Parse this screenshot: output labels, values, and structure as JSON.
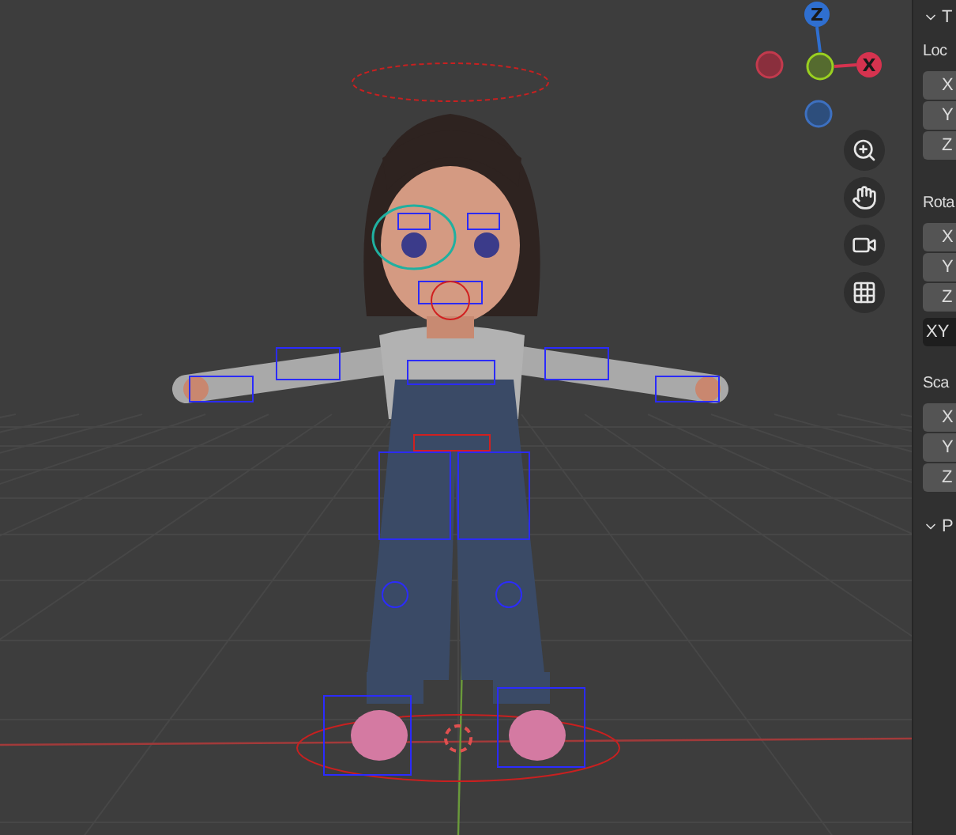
{
  "viewport": {
    "gizmo": {
      "axes": [
        {
          "kind": "z",
          "label": "Z"
        },
        {
          "kind": "x",
          "label": "X"
        }
      ]
    },
    "nav_buttons": [
      {
        "kind": "zoom"
      },
      {
        "kind": "pan"
      },
      {
        "kind": "camera"
      },
      {
        "kind": "perspective"
      }
    ]
  },
  "sidebar": {
    "panels": [
      {
        "header": "T",
        "expanded": true,
        "groups": [
          {
            "label": "Loc",
            "fields": [
              "X",
              "Y",
              "Z"
            ]
          },
          {
            "label": "Rota",
            "fields": [
              "X",
              "Y",
              "Z"
            ],
            "mode": "XY"
          },
          {
            "label": "Sca",
            "fields": [
              "X",
              "Y",
              "Z"
            ]
          }
        ]
      },
      {
        "header": "P",
        "expanded": true
      }
    ]
  }
}
